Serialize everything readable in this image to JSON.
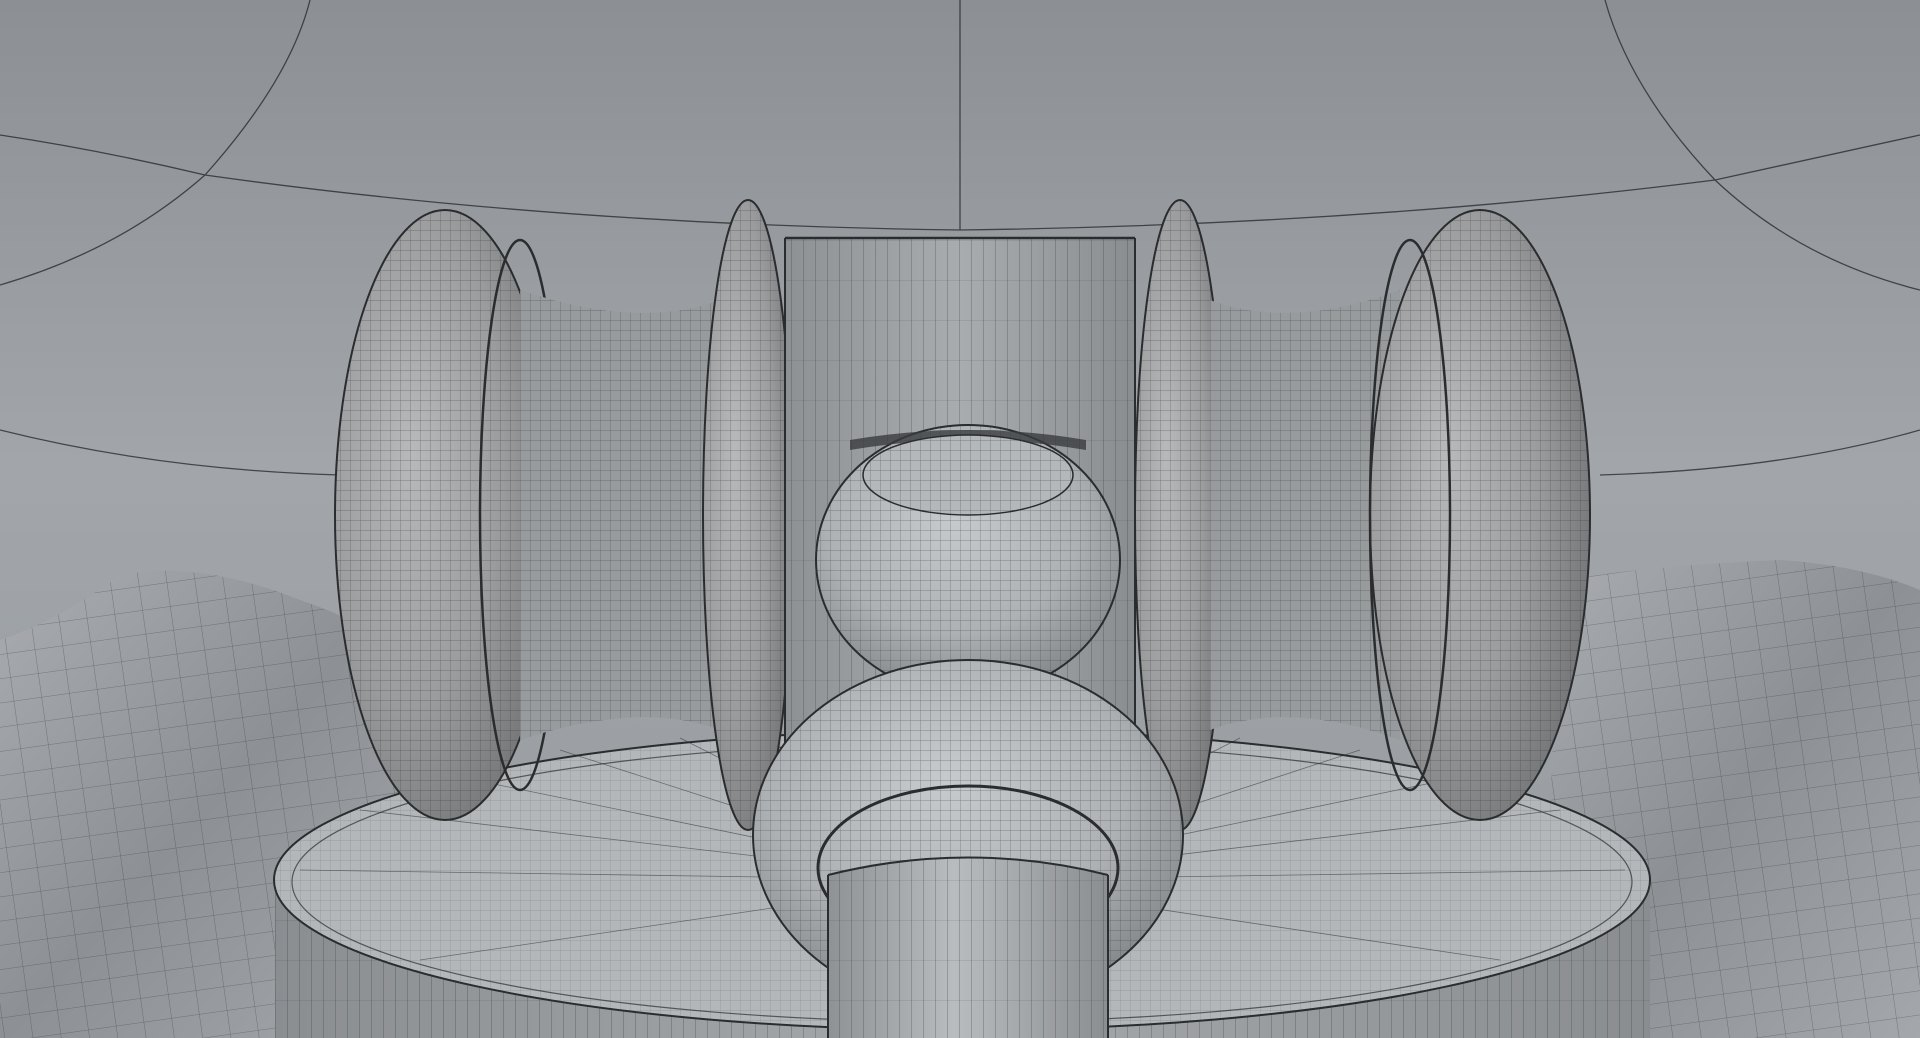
{
  "scene": {
    "subject": "gavel-on-sound-block-wireframe-render",
    "colors": {
      "background_top": "#8e9296",
      "background_mid": "#a3a7ab",
      "surface_light": "#c2c5c8",
      "surface_mid": "#a8abaf",
      "surface_dark": "#6f7276",
      "wire": "#2a2c2e"
    },
    "elements": [
      "backdrop-sphere",
      "cloth-drape",
      "sound-block",
      "gavel-head",
      "gavel-handle"
    ]
  }
}
